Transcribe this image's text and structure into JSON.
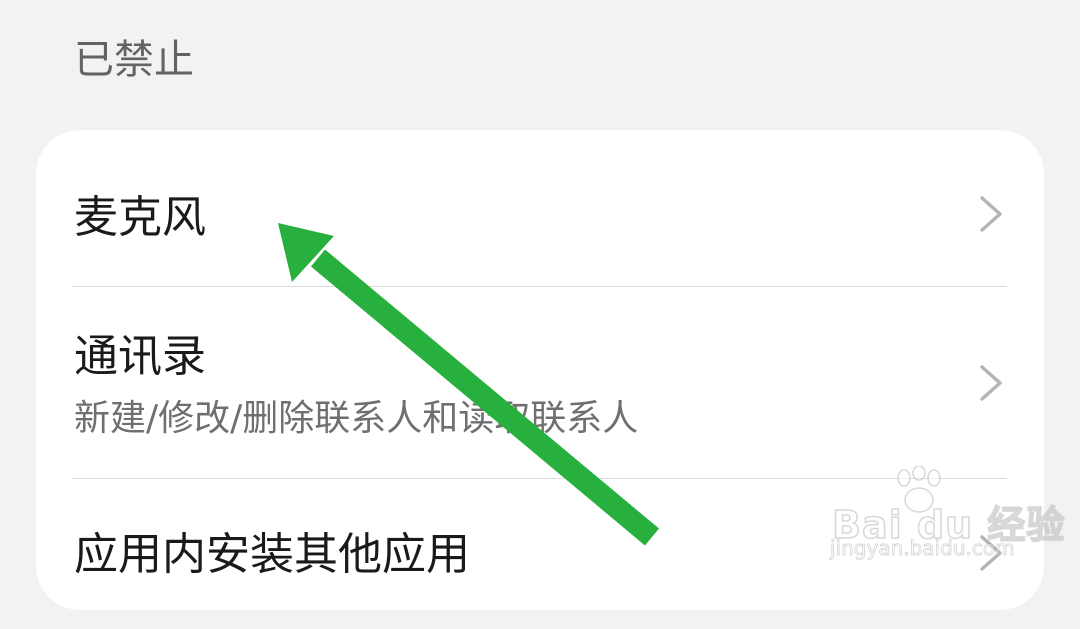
{
  "section": {
    "header": "已禁止"
  },
  "permissions": {
    "items": [
      {
        "title": "麦克风",
        "subtitle": ""
      },
      {
        "title": "通讯录",
        "subtitle": "新建/修改/删除联系人和读取联系人"
      },
      {
        "title": "应用内安装其他应用",
        "subtitle": ""
      }
    ]
  },
  "icons": {
    "chevron": "chevron-right-icon",
    "annotation": "green-arrow-icon"
  },
  "colors": {
    "background": "#f1f2f4",
    "card": "#ffffff",
    "title_text": "#1a1a1a",
    "subtitle_text": "#6f6f6f",
    "header_text": "#636363",
    "chevron": "#b5b5b5",
    "arrow": "#27b03e"
  },
  "watermark": {
    "brand": "Bai du 经验",
    "url": "jingyan.baidu.com"
  }
}
